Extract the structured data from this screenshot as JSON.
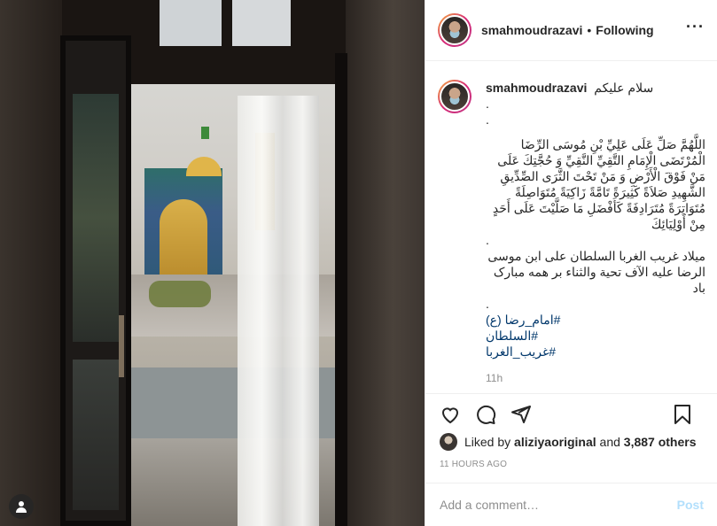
{
  "post": {
    "username": "smahmoudrazavi",
    "follow_status": "Following",
    "caption": {
      "greeting": "سلام علیکم",
      "dots1": ".",
      "dots2": ".",
      "prayer": "اللَّهُمَّ صَلِّ عَلَى عَلِيِّ بْنِ مُوسَى الرِّضَا الْمُرْتَضَى الْإِمَامِ التَّقِيِّ النَّقِيِّ وَ حُجَّتِكَ عَلَى مَنْ فَوْقَ الْأَرْضِ وَ مَنْ تَحْتَ الثَّرَى الصِّدِّيقِ الشَّهِيدِ صَلاَةً كَثِيرَةً تَامَّةً زَاكِيَةً مُتَوَاصِلَةً مُتَوَاتِرَةً مُتَرَادِفَةً كَأَفْضَلِ مَا صَلَّيْتَ عَلَى أَحَدٍ مِنْ أَوْلِيَائِكَ",
      "dots3": ".",
      "birthday": "میلاد غریب الغربا السلطان علی ابن موسی الرضا علیه الآف تحیة والثناء بر همه مبارک باد",
      "dots4": ".",
      "hashtags": [
        "#امام_رضا (ع)",
        "#السلطان",
        "#غریب_الغربا"
      ],
      "time": "11h"
    },
    "likes": {
      "prefix": "Liked by",
      "liker": "aliziyaoriginal",
      "conjunction": "and",
      "others": "3,887 others"
    },
    "time_ago": "11 HOURS AGO",
    "comment_box": {
      "placeholder": "Add a comment…",
      "post_label": "Post"
    },
    "icons": {
      "like": "heart-icon",
      "comment": "comment-icon",
      "share": "paper-plane-icon",
      "save": "bookmark-icon",
      "more": "more-icon",
      "user_tag": "user-tag-icon"
    }
  }
}
